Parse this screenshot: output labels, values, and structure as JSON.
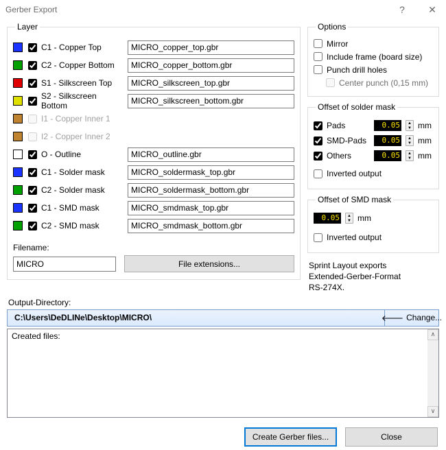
{
  "title": "Gerber Export",
  "layer_group": "Layer",
  "layers": [
    {
      "color": "#1a33ff",
      "chk": true,
      "enabled": true,
      "label": "C1 - Copper Top",
      "fname": "MICRO_copper_top.gbr"
    },
    {
      "color": "#00a000",
      "chk": true,
      "enabled": true,
      "label": "C2 - Copper Bottom",
      "fname": "MICRO_copper_bottom.gbr"
    },
    {
      "color": "#e00000",
      "chk": true,
      "enabled": true,
      "label": "S1 - Silkscreen Top",
      "fname": "MICRO_silkscreen_top.gbr"
    },
    {
      "color": "#e0e000",
      "chk": true,
      "enabled": true,
      "label": "S2 - Silkscreen Bottom",
      "fname": "MICRO_silkscreen_bottom.gbr"
    },
    {
      "color": "#c0832f",
      "chk": false,
      "enabled": false,
      "label": "I1 - Copper Inner 1",
      "fname": ""
    },
    {
      "color": "#c0832f",
      "chk": false,
      "enabled": false,
      "label": "I2 - Copper Inner 2",
      "fname": ""
    },
    {
      "color": "#ffffff",
      "chk": true,
      "enabled": true,
      "label": "O - Outline",
      "fname": "MICRO_outline.gbr"
    },
    {
      "color": "#1a33ff",
      "chk": true,
      "enabled": true,
      "label": "C1 - Solder mask",
      "fname": "MICRO_soldermask_top.gbr"
    },
    {
      "color": "#00a000",
      "chk": true,
      "enabled": true,
      "label": "C2 - Solder mask",
      "fname": "MICRO_soldermask_bottom.gbr"
    },
    {
      "color": "#1a33ff",
      "chk": true,
      "enabled": true,
      "label": "C1 - SMD mask",
      "fname": "MICRO_smdmask_top.gbr"
    },
    {
      "color": "#00a000",
      "chk": true,
      "enabled": true,
      "label": "C2 - SMD mask",
      "fname": "MICRO_smdmask_bottom.gbr"
    }
  ],
  "filename_label": "Filename:",
  "filename": "MICRO",
  "file_ext_btn": "File extensions...",
  "options_group": "Options",
  "options_mirror": "Mirror",
  "options_include_frame": "Include frame (board size)",
  "options_punch": "Punch drill holes",
  "options_center_punch": "Center punch (0,15 mm)",
  "solder_group": "Offset of solder mask",
  "solder_pads": "Pads",
  "solder_smdpads": "SMD-Pads",
  "solder_others": "Others",
  "solder_val": "0.05",
  "unit_mm": "mm",
  "solder_inverted": "Inverted output",
  "smd_group": "Offset of SMD mask",
  "smd_val": "0.05",
  "smd_inverted": "Inverted output",
  "notes_l1": "Sprint Layout exports",
  "notes_l2": "Extended-Gerber-Format",
  "notes_l3": "RS-274X.",
  "outdir_label": "Output-Directory:",
  "outdir_path": "C:\\Users\\DeDLINe\\Desktop\\MICRO\\",
  "outdir_change": "Change...",
  "created_label": "Created files:",
  "btn_create": "Create Gerber files...",
  "btn_close": "Close"
}
